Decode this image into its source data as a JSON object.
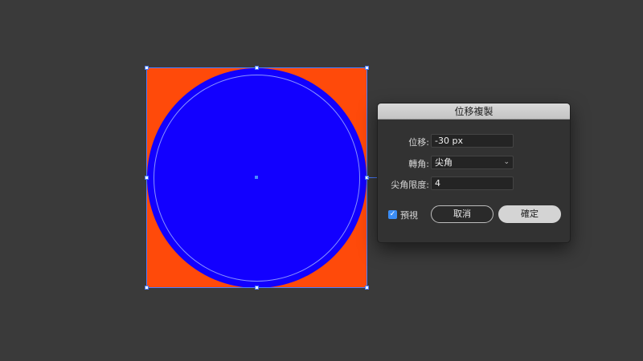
{
  "dialog": {
    "title": "位移複製",
    "offset_label": "位移:",
    "offset_value": "-30 px",
    "joins_label": "轉角:",
    "joins_value": "尖角",
    "miter_label": "尖角限度:",
    "miter_value": "4",
    "preview_label": "預視",
    "preview_checked": true,
    "cancel_label": "取消",
    "ok_label": "確定"
  },
  "colors": {
    "canvas_bg": "#3a3a3a",
    "square_fill": "#ff4a0a",
    "circle_fill": "#1200ff",
    "selection_color": "#4a7cff"
  },
  "icons": {
    "caret": "chevron-down-icon",
    "check": "checkmark-icon"
  }
}
